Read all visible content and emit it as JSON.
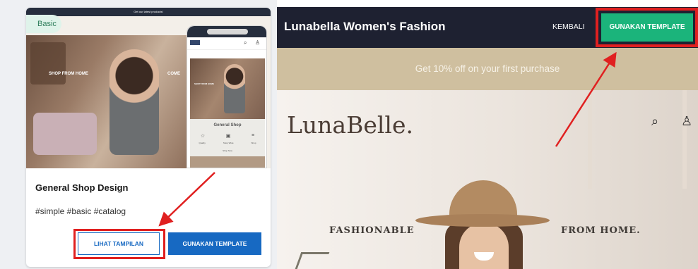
{
  "left_card": {
    "badge_label": "Basic",
    "menu_icon": "hamburger-icon",
    "topbar_text": "Get our latest products!",
    "desktop_hero": {
      "text_left": "SHOP FROM HOME",
      "text_right": "COME"
    },
    "mobile": {
      "url_text": "",
      "shop_title": "General Shop",
      "shop_icons": [
        "star-icon",
        "box-icon",
        "menu-icon"
      ],
      "shop_labels": [
        "Quality",
        "Shop Wide",
        "Shop"
      ],
      "shop_now": "Shop Now"
    },
    "title": "General Shop Design",
    "tags": "#simple #basic #catalog",
    "btn_preview": "LIHAT TAMPILAN",
    "btn_use": "GUNAKAN TEMPLATE"
  },
  "right_preview": {
    "title": "Lunabella Women's Fashion",
    "back_label": "KEMBALI",
    "use_label": "GUNAKAN TEMPLATE",
    "promo": "Get 10% off on your first purchase",
    "logo": "LunaBelle.",
    "search_icon": "search-icon",
    "user_icon": "user-icon",
    "hero_left": "FASHIONABLE",
    "hero_right": "FROM HOME."
  },
  "colors": {
    "primary_blue": "#1769c2",
    "green": "#1bb47b",
    "navbar": "#1e2131",
    "highlight_red": "#e02020",
    "promo_bar": "#cfbf9f"
  }
}
